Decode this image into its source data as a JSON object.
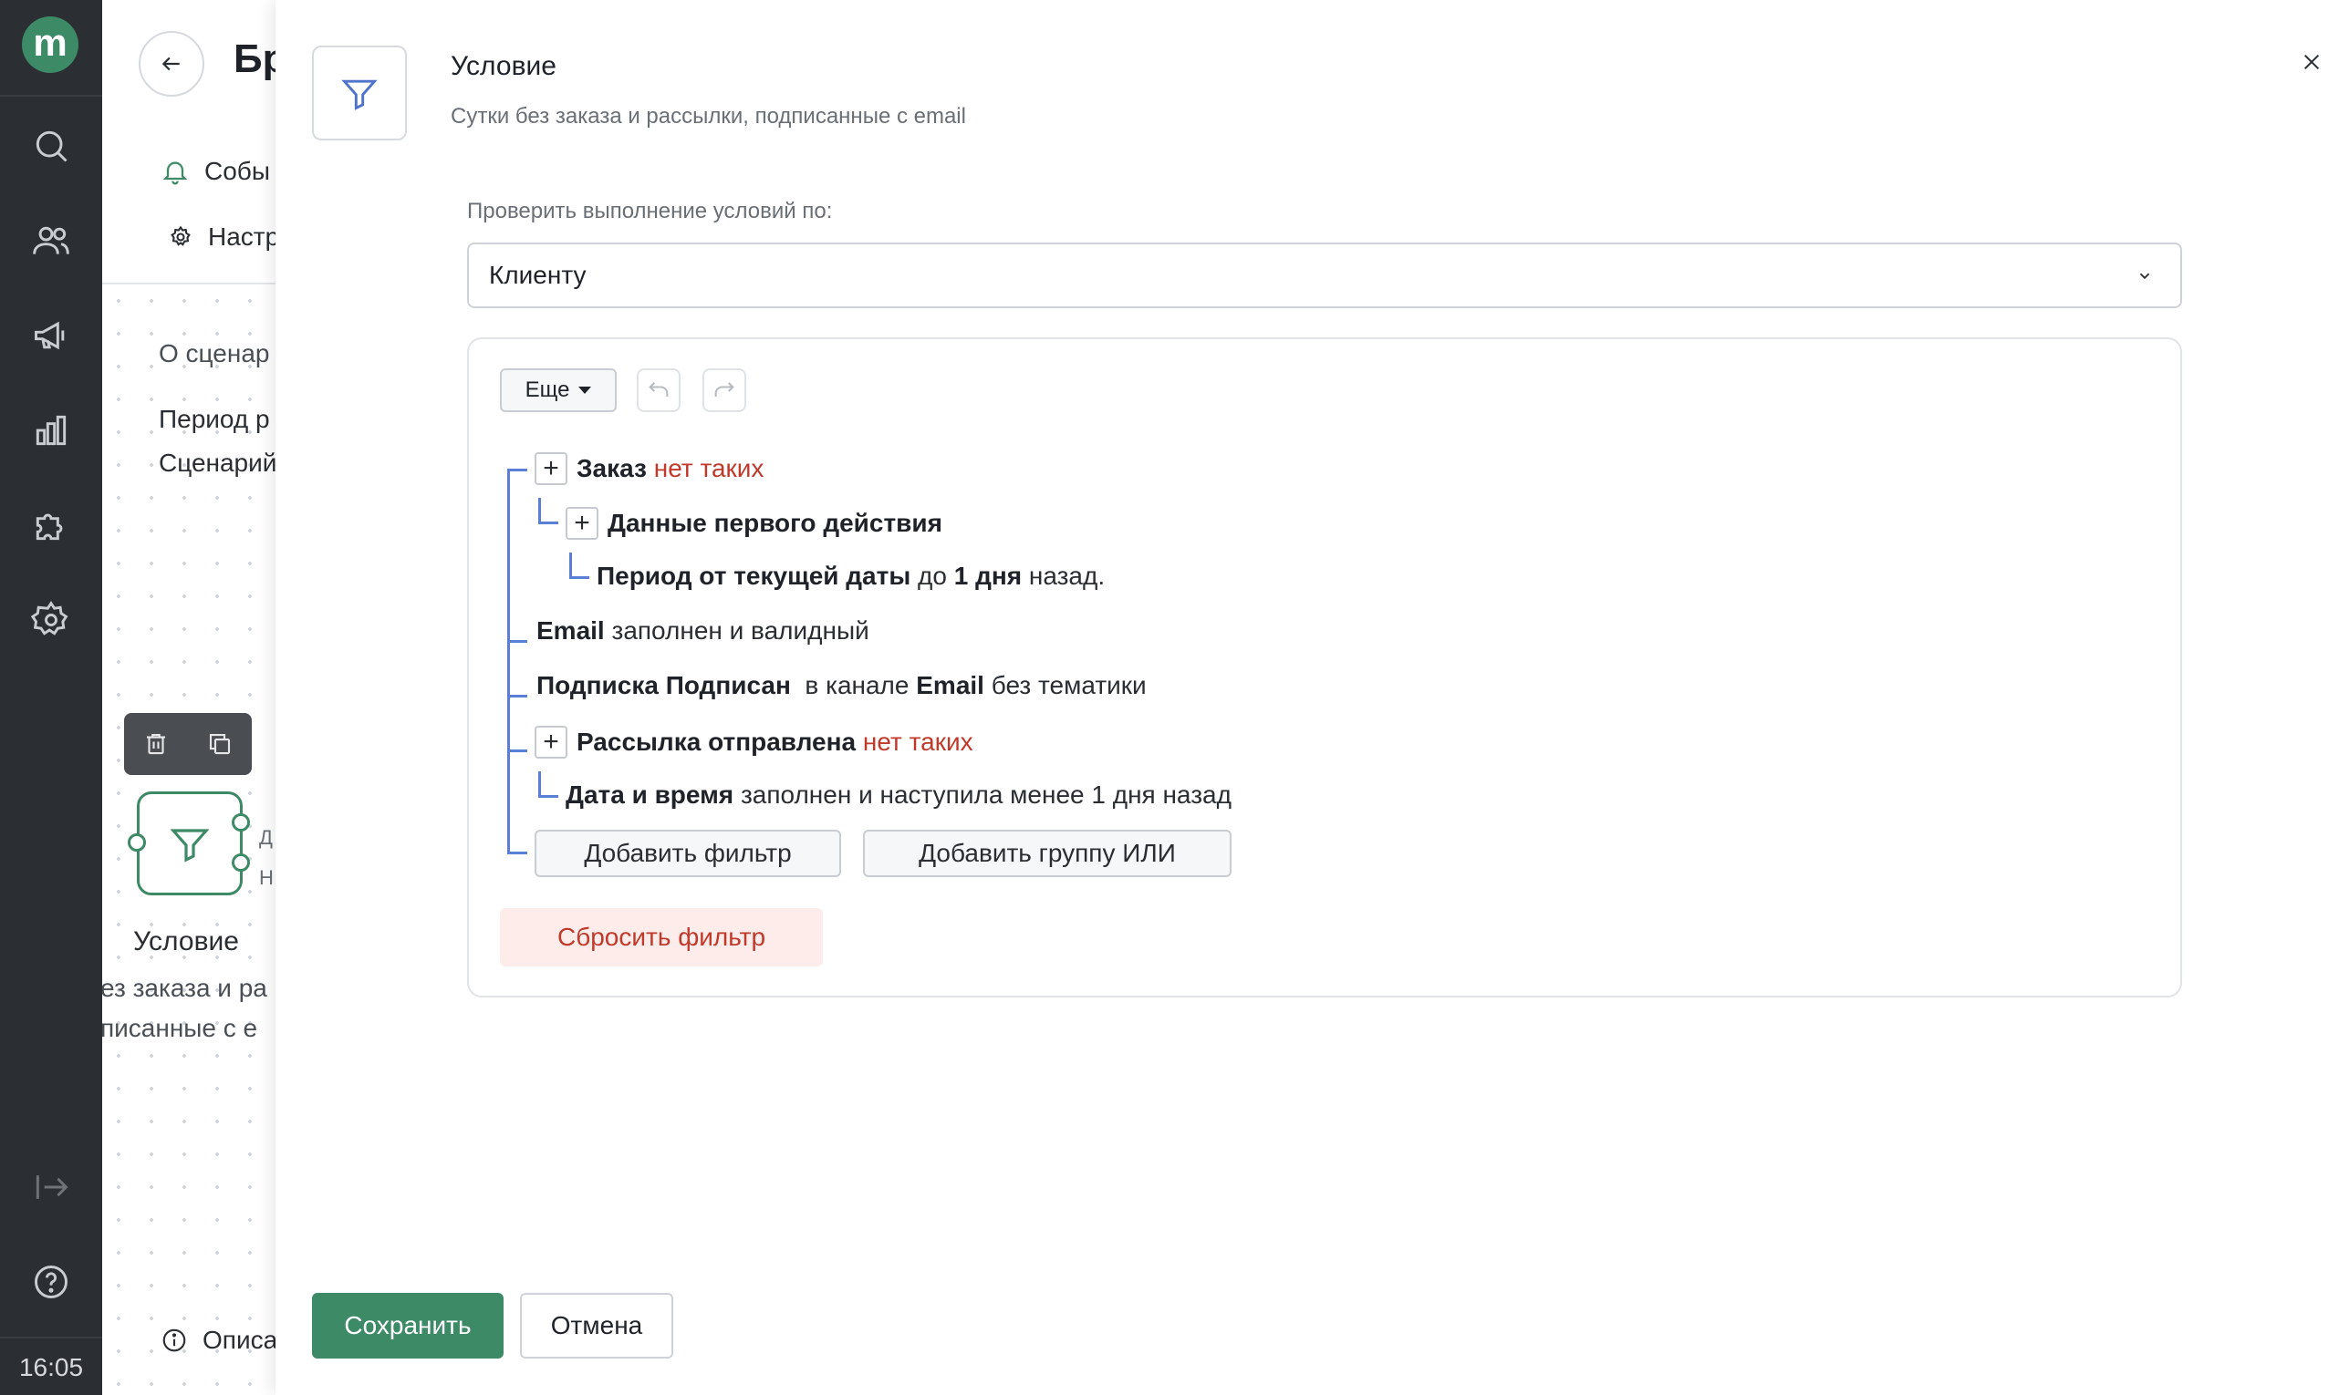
{
  "nav": {
    "logo": "m",
    "items": [
      {
        "icon": "search-icon"
      },
      {
        "icon": "users-icon"
      },
      {
        "icon": "megaphone-icon"
      },
      {
        "icon": "bar-chart-icon"
      },
      {
        "icon": "puzzle-icon"
      },
      {
        "icon": "gear-icon"
      }
    ],
    "bottom": [
      {
        "icon": "collapse-icon"
      },
      {
        "icon": "help-icon"
      }
    ],
    "time": "16:05"
  },
  "background": {
    "title": "Бр",
    "menu": [
      "Собы",
      "Настр"
    ],
    "about": "О сценар",
    "info": [
      "Период р",
      "Сценарий"
    ],
    "node_label": "Условие",
    "node_desc": [
      "ез заказа и ра",
      "писанные с е"
    ],
    "node_side": [
      "Д",
      "Н"
    ],
    "footer": "Описа"
  },
  "modal": {
    "title": "Условие",
    "subtitle": "Сутки без заказа и рассылки, подписанные с email",
    "check_label": "Проверить выполнение условий по:",
    "check_value": "Клиенту",
    "more_label": "Еще",
    "rules": [
      {
        "bold": "Заказ",
        "neg": "нет таких"
      },
      {
        "bold": "Данные первого действия"
      },
      {
        "bold1": "Период от текущей даты",
        "mid": "до",
        "bold2": "1 дня",
        "tail": "назад."
      },
      {
        "bold": "Email",
        "tail": "заполнен и валидный"
      },
      {
        "bold1": "Подписка Подписан",
        "mid": "в канале",
        "bold2": "Email",
        "tail": "без тематики"
      },
      {
        "bold": "Рассылка отправлена",
        "neg": "нет таких"
      },
      {
        "bold": "Дата и время",
        "tail": "заполнен и наступила менее 1 дня назад"
      }
    ],
    "add_filter": "Добавить фильтр",
    "add_group": "Добавить группу ИЛИ",
    "reset": "Сбросить фильтр",
    "save": "Сохранить",
    "cancel": "Отмена"
  },
  "colors": {
    "accent": "#3d8a66",
    "negative": "#c0392b",
    "tree_line": "#5b7fd6",
    "nav_bg": "#2b2e33"
  }
}
